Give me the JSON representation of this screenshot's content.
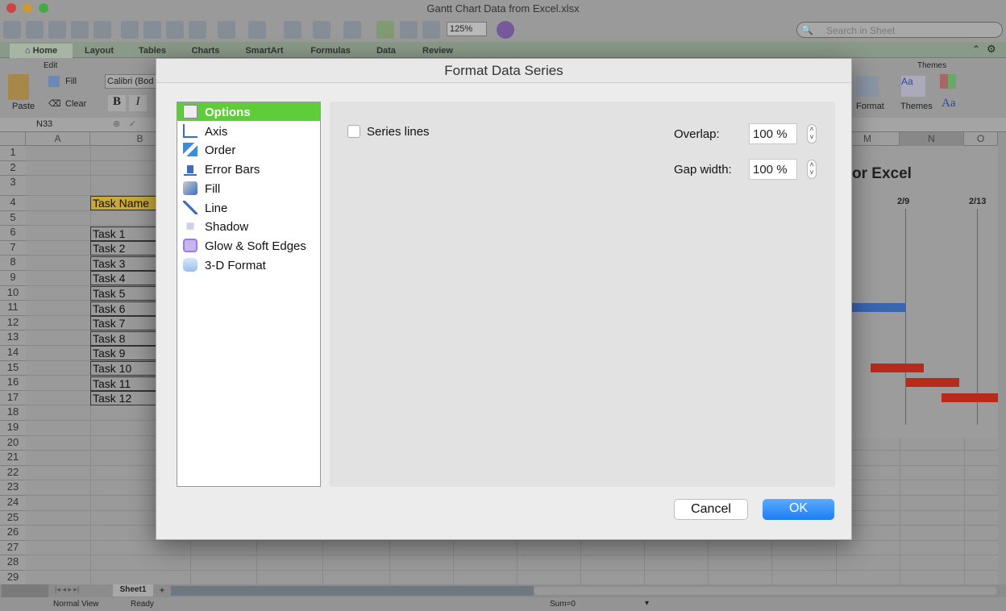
{
  "window": {
    "title": "Gantt Chart Data from Excel.xlsx"
  },
  "toolbar": {
    "zoom": "125%",
    "search_placeholder": "Search in Sheet"
  },
  "ribbon_tabs": [
    "Home",
    "Layout",
    "Tables",
    "Charts",
    "SmartArt",
    "Formulas",
    "Data",
    "Review"
  ],
  "ribbon": {
    "edit_group": "Edit",
    "paste": "Paste",
    "fill": "Fill",
    "clear": "Clear",
    "font": "Calibri (Bod",
    "bold": "B",
    "italic": "I",
    "themes_group": "Themes",
    "format": "Format",
    "themes": "Themes",
    "aa": "Aa"
  },
  "formula_bar": {
    "cell_ref": "N33"
  },
  "columns": [
    "A",
    "B",
    "M",
    "N",
    "O"
  ],
  "rows": [
    "1",
    "2",
    "3",
    "4",
    "5",
    "6",
    "7",
    "8",
    "9",
    "10",
    "11",
    "12",
    "13",
    "14",
    "15",
    "16",
    "17",
    "18",
    "19",
    "20",
    "21",
    "22",
    "23",
    "24",
    "25",
    "26",
    "27",
    "28",
    "29"
  ],
  "sheet": {
    "header": "Task Name",
    "tasks": [
      "Task 1",
      "Task 2",
      "Task 3",
      "Task 4",
      "Task 5",
      "Task 6",
      "Task 7",
      "Task 8",
      "Task 9",
      "Task 10",
      "Task 11",
      "Task 12"
    ],
    "chart_title_fragment": "or Excel",
    "date_labels": [
      "2/9",
      "2/13"
    ],
    "colors": {
      "header_fill": "#c9a93a",
      "bar_blue": "#3a66b0",
      "bar_red": "#b82a1a"
    }
  },
  "sheet_tabs": {
    "active": "Sheet1",
    "add": "+"
  },
  "status": {
    "view": "Normal View",
    "state": "Ready",
    "sum": "Sum=0"
  },
  "dialog": {
    "title": "Format Data Series",
    "categories": [
      {
        "label": "Options",
        "icon": "options-icon",
        "selected": true
      },
      {
        "label": "Axis",
        "icon": "axis-icon"
      },
      {
        "label": "Order",
        "icon": "order-icon"
      },
      {
        "label": "Error Bars",
        "icon": "error-bars-icon"
      },
      {
        "label": "Fill",
        "icon": "fill-bucket-icon"
      },
      {
        "label": "Line",
        "icon": "line-icon"
      },
      {
        "label": "Shadow",
        "icon": "shadow-icon"
      },
      {
        "label": "Glow & Soft Edges",
        "icon": "glow-icon"
      },
      {
        "label": "3-D Format",
        "icon": "3d-format-icon"
      }
    ],
    "series_lines": {
      "label": "Series lines",
      "checked": false
    },
    "overlap": {
      "label": "Overlap:",
      "value": "100 %"
    },
    "gap_width": {
      "label": "Gap width:",
      "value": "100 %"
    },
    "cancel": "Cancel",
    "ok": "OK",
    "colors": {
      "selected": "#5fcc3a",
      "ok": "#2f8ff6"
    }
  }
}
